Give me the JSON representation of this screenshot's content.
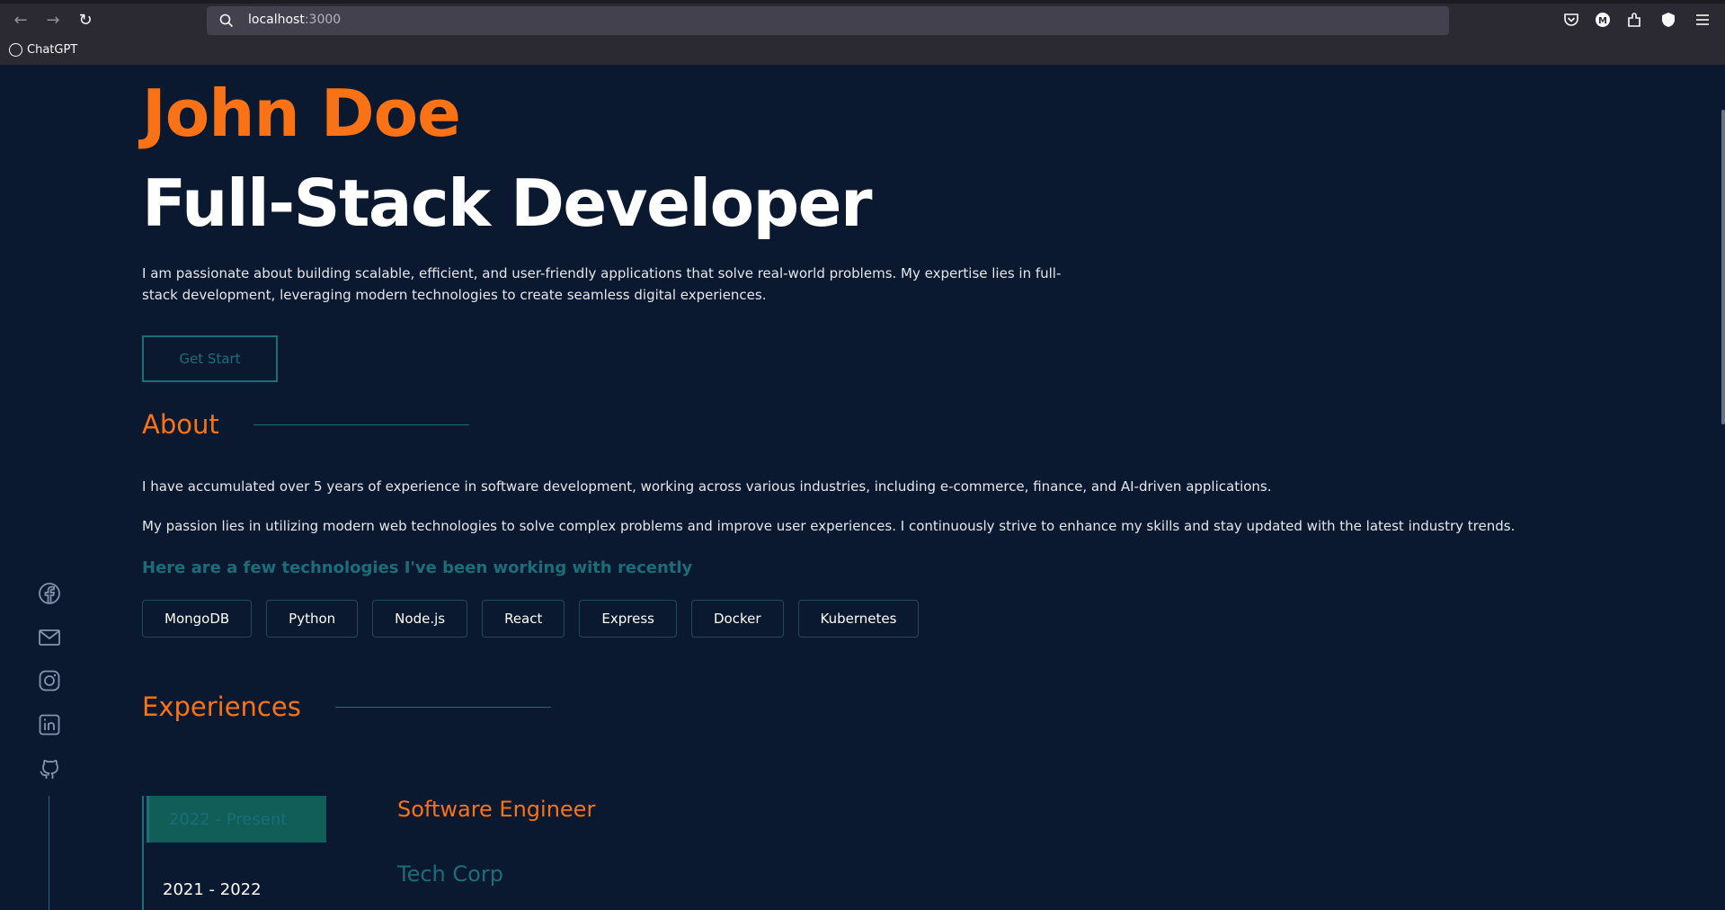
{
  "browser": {
    "url_host": "localhost",
    "url_port": ":3000",
    "bookmark": "ChatGPT",
    "toolbar_icons": [
      "back-icon",
      "forward-icon",
      "reload-icon",
      "search-icon",
      "pocket-icon",
      "account-icon",
      "extensions-icon",
      "shield-icon",
      "menu-icon"
    ]
  },
  "hero": {
    "name": "John Doe",
    "title": "Full-Stack Developer",
    "description": "I am passionate about building scalable, efficient, and user-friendly applications that solve real-world problems. My expertise lies in full-stack development, leveraging modern technologies to create seamless digital experiences.",
    "cta_label": "Get Start"
  },
  "about": {
    "heading": "About",
    "paragraphs": [
      "I have accumulated over 5 years of experience in software development, working across various industries, including e-commerce, finance, and AI-driven applications.",
      "My passion lies in utilizing modern web technologies to solve complex problems and improve user experiences. I continuously strive to enhance my skills and stay updated with the latest industry trends."
    ],
    "tech_heading": "Here are a few technologies I've been working with recently",
    "technologies": [
      "MongoDB",
      "Python",
      "Node.js",
      "React",
      "Express",
      "Docker",
      "Kubernetes"
    ]
  },
  "experiences": {
    "heading": "Experiences",
    "tabs": [
      "2022 - Present",
      "2021 - 2022"
    ],
    "active_role": "Software Engineer",
    "active_company": "Tech Corp"
  },
  "social_icons": [
    "facebook-icon",
    "mail-icon",
    "instagram-icon",
    "linkedin-icon",
    "github-icon"
  ],
  "colors": {
    "background": "#0a192f",
    "accent": "#f97316",
    "teal": "#1b6e78",
    "text": "#e5e7eb"
  }
}
